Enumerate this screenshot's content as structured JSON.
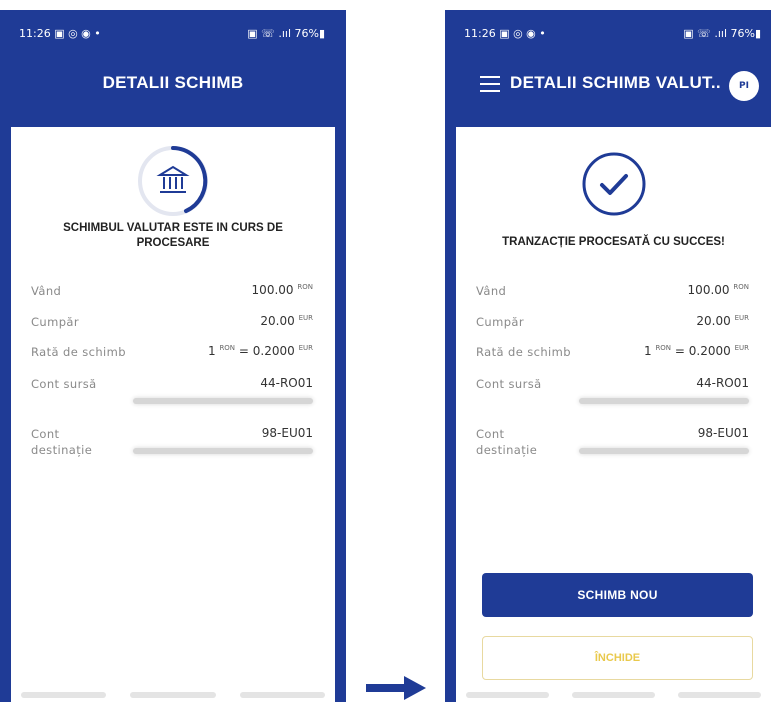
{
  "left": {
    "status": {
      "time": "11:26 ▣ ◎ ◉  •",
      "system": "▣ ☏ .ııl 76%▮"
    },
    "title": "DETALII SCHIMB",
    "icon": "bank-icon",
    "heading": "SCHIMBUL VALUTAR ESTE IN CURS DE PROCESARE",
    "rows": [
      {
        "label": "Vând",
        "value": "100.00",
        "currency": "RON"
      },
      {
        "label": "Cumpăr",
        "value": "20.00",
        "currency": "EUR"
      },
      {
        "label": "Rată de schimb",
        "rate_left": "1",
        "rate_left_cur": "RON",
        "rate_right": "= 0.2000",
        "rate_right_cur": "EUR"
      },
      {
        "label": "Cont sursă",
        "value": "44-RO01"
      },
      {
        "label": "Cont destinație",
        "value": "98-EU01"
      }
    ]
  },
  "right": {
    "status": {
      "time": "11:26 ▣ ◎ ◉  •",
      "system": "▣ ☏ .ııl 76%▮"
    },
    "title": "DETALII SCHIMB VALUT...",
    "avatar": "PI",
    "icon": "checkmark-icon",
    "heading": "TRANZACȚIE PROCESATĂ CU SUCCES!",
    "rows": [
      {
        "label": "Vând",
        "value": "100.00",
        "currency": "RON"
      },
      {
        "label": "Cumpăr",
        "value": "20.00",
        "currency": "EUR"
      },
      {
        "label": "Rată de schimb",
        "rate_left": "1",
        "rate_left_cur": "RON",
        "rate_right": "= 0.2000",
        "rate_right_cur": "EUR"
      },
      {
        "label": "Cont sursă",
        "value": "44-RO01"
      },
      {
        "label": "Cont destinație",
        "value": "98-EU01"
      }
    ],
    "primary_button": "SCHIMB NOU",
    "secondary_button": "ÎNCHIDE"
  },
  "colors": {
    "brand": "#1f3b96",
    "accent_gold": "#e9c94c"
  }
}
